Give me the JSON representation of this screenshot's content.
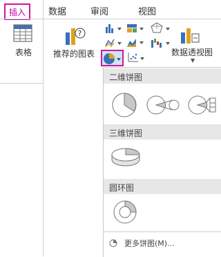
{
  "tabs": {
    "insert": "插入",
    "data": "数据",
    "review": "审阅",
    "view": "视图"
  },
  "ribbon": {
    "table_label": "表格",
    "recommended_label": "推荐的图表",
    "pivot_label": "数据透视图"
  },
  "flyout": {
    "section_2d": "二维饼图",
    "section_3d": "三维饼图",
    "section_donut": "圆环图",
    "more_label": "更多饼图(M)..."
  },
  "colors": {
    "accent": "#d4149b",
    "section_bg": "#e7e7e7"
  },
  "icons": [
    "table-icon",
    "recommended-charts-icon",
    "column-chart-icon",
    "hierarchy-chart-icon",
    "pie-chart-icon",
    "scatter-chart-icon",
    "pivot-chart-icon",
    "line-chart-icon",
    "waterfall-chart-icon",
    "radar-chart-icon",
    "area-chart-icon",
    "combo-chart-icon"
  ]
}
